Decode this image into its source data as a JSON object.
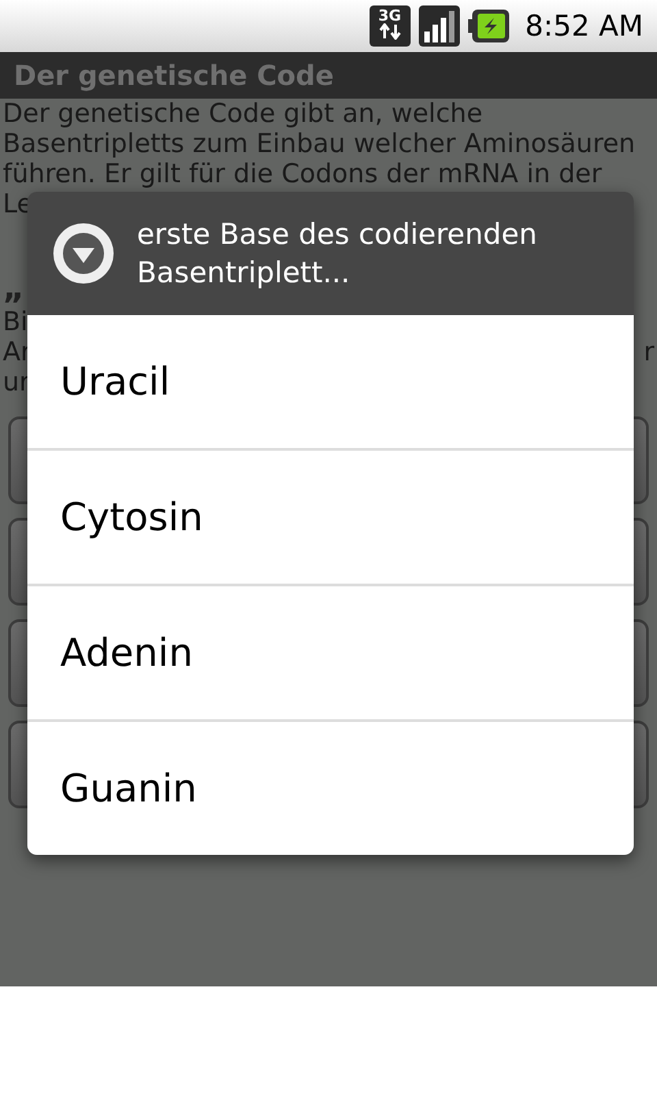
{
  "status_bar": {
    "network_label": "3G",
    "time": "8:52 AM"
  },
  "title_bar": {
    "title": "Der genetische Code"
  },
  "content": {
    "lines": [
      {
        "kind": "text",
        "left": "Der genetische Code gibt an, welche"
      },
      {
        "kind": "text",
        "left": "Basentripletts zum Einbau welcher Aminosäuren"
      },
      {
        "kind": "text",
        "left": "führen. Er gilt für die Codons der mRNA in der"
      },
      {
        "kind": "text",
        "left": "Le"
      },
      {
        "kind": "heading",
        "left": "„"
      },
      {
        "kind": "text",
        "left": "Bi"
      },
      {
        "kind": "text",
        "left": "Ar",
        "right": "r"
      },
      {
        "kind": "text",
        "left": "ur"
      }
    ]
  },
  "dialog": {
    "title": "erste Base des codierenden Basentriplett...",
    "items": [
      {
        "label": "Uracil"
      },
      {
        "label": "Cytosin"
      },
      {
        "label": "Adenin"
      },
      {
        "label": "Guanin"
      }
    ]
  }
}
